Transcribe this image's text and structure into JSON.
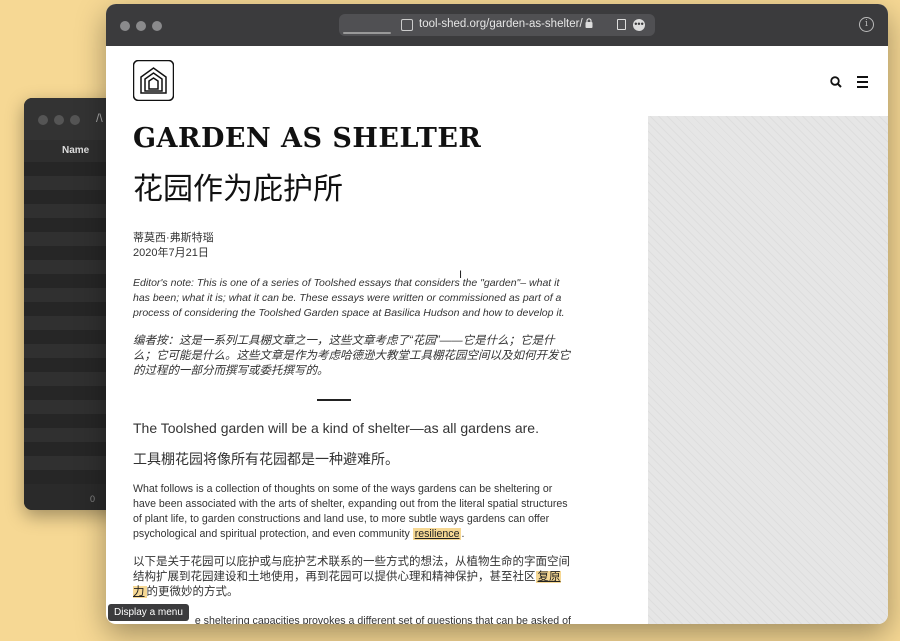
{
  "back_window": {
    "title": "/\\",
    "column_name": "Name",
    "footer_text": "0 "
  },
  "browser": {
    "url": "tool-shed.org/garden-as-shelter/",
    "lock_icon": "lock-icon",
    "info_icon": "info-icon"
  },
  "site": {
    "logo_icon": "toolshed-house-logo",
    "search_icon": "search-icon",
    "menu_icon": "hamburger-menu-icon"
  },
  "article": {
    "title_en": "GARDEN AS SHELTER",
    "title_zh": "花园作为庇护所",
    "author": "蒂莫西·弗斯特瑙",
    "date": "2020年7月21日",
    "editors_note_en": "Editor's note: This is one of a series of Toolshed essays that considers the \"garden\"– what it has been; what it is; what it can be. These essays were written or commissioned as part of a process of considering the Toolshed Garden space at Basilica Hudson and how to develop it.",
    "editors_note_zh": "编者按：这是一系列工具棚文章之一，这些文章考虑了“花园”——它是什么；它是什么；它可能是什么。这些文章是作为考虑哈德逊大教堂工具棚花园空间以及如何开发它的过程的一部分而撰写或委托撰写的。",
    "lead_en": "The Toolshed garden will be a kind of shelter—as all gardens are.",
    "lead_zh": "工具棚花园将像所有花园都是一种避难所。",
    "para1_en": "What follows is a collection of thoughts on some of the ways gardens can be sheltering or have been associated with the arts of shelter, expanding out from the literal spatial structures of plant life, to garden constructions and land use, to more subtle ways gardens can offer psychological and spiritual protection, and even community ",
    "para1_en_highlight": "resilience",
    "para1_en_end": ".",
    "para1_zh": "以下是关于花园可以庇护或与庇护艺术联系的一些方式的想法，从植物生命的字面空间结构扩展到花园建设和土地使用，再到花园可以提供心理和精神保护，甚至社区",
    "para1_zh_highlight": "复原力",
    "para1_zh_end": "的更微妙的方式。",
    "para2_en_partial": "e sheltering capacities provokes a different set of questions that can be asked of"
  },
  "tooltip": "Display a menu",
  "colors": {
    "desktop": "#f6d894",
    "highlight": "#f6d894",
    "toolbar": "#3b3b3d"
  }
}
